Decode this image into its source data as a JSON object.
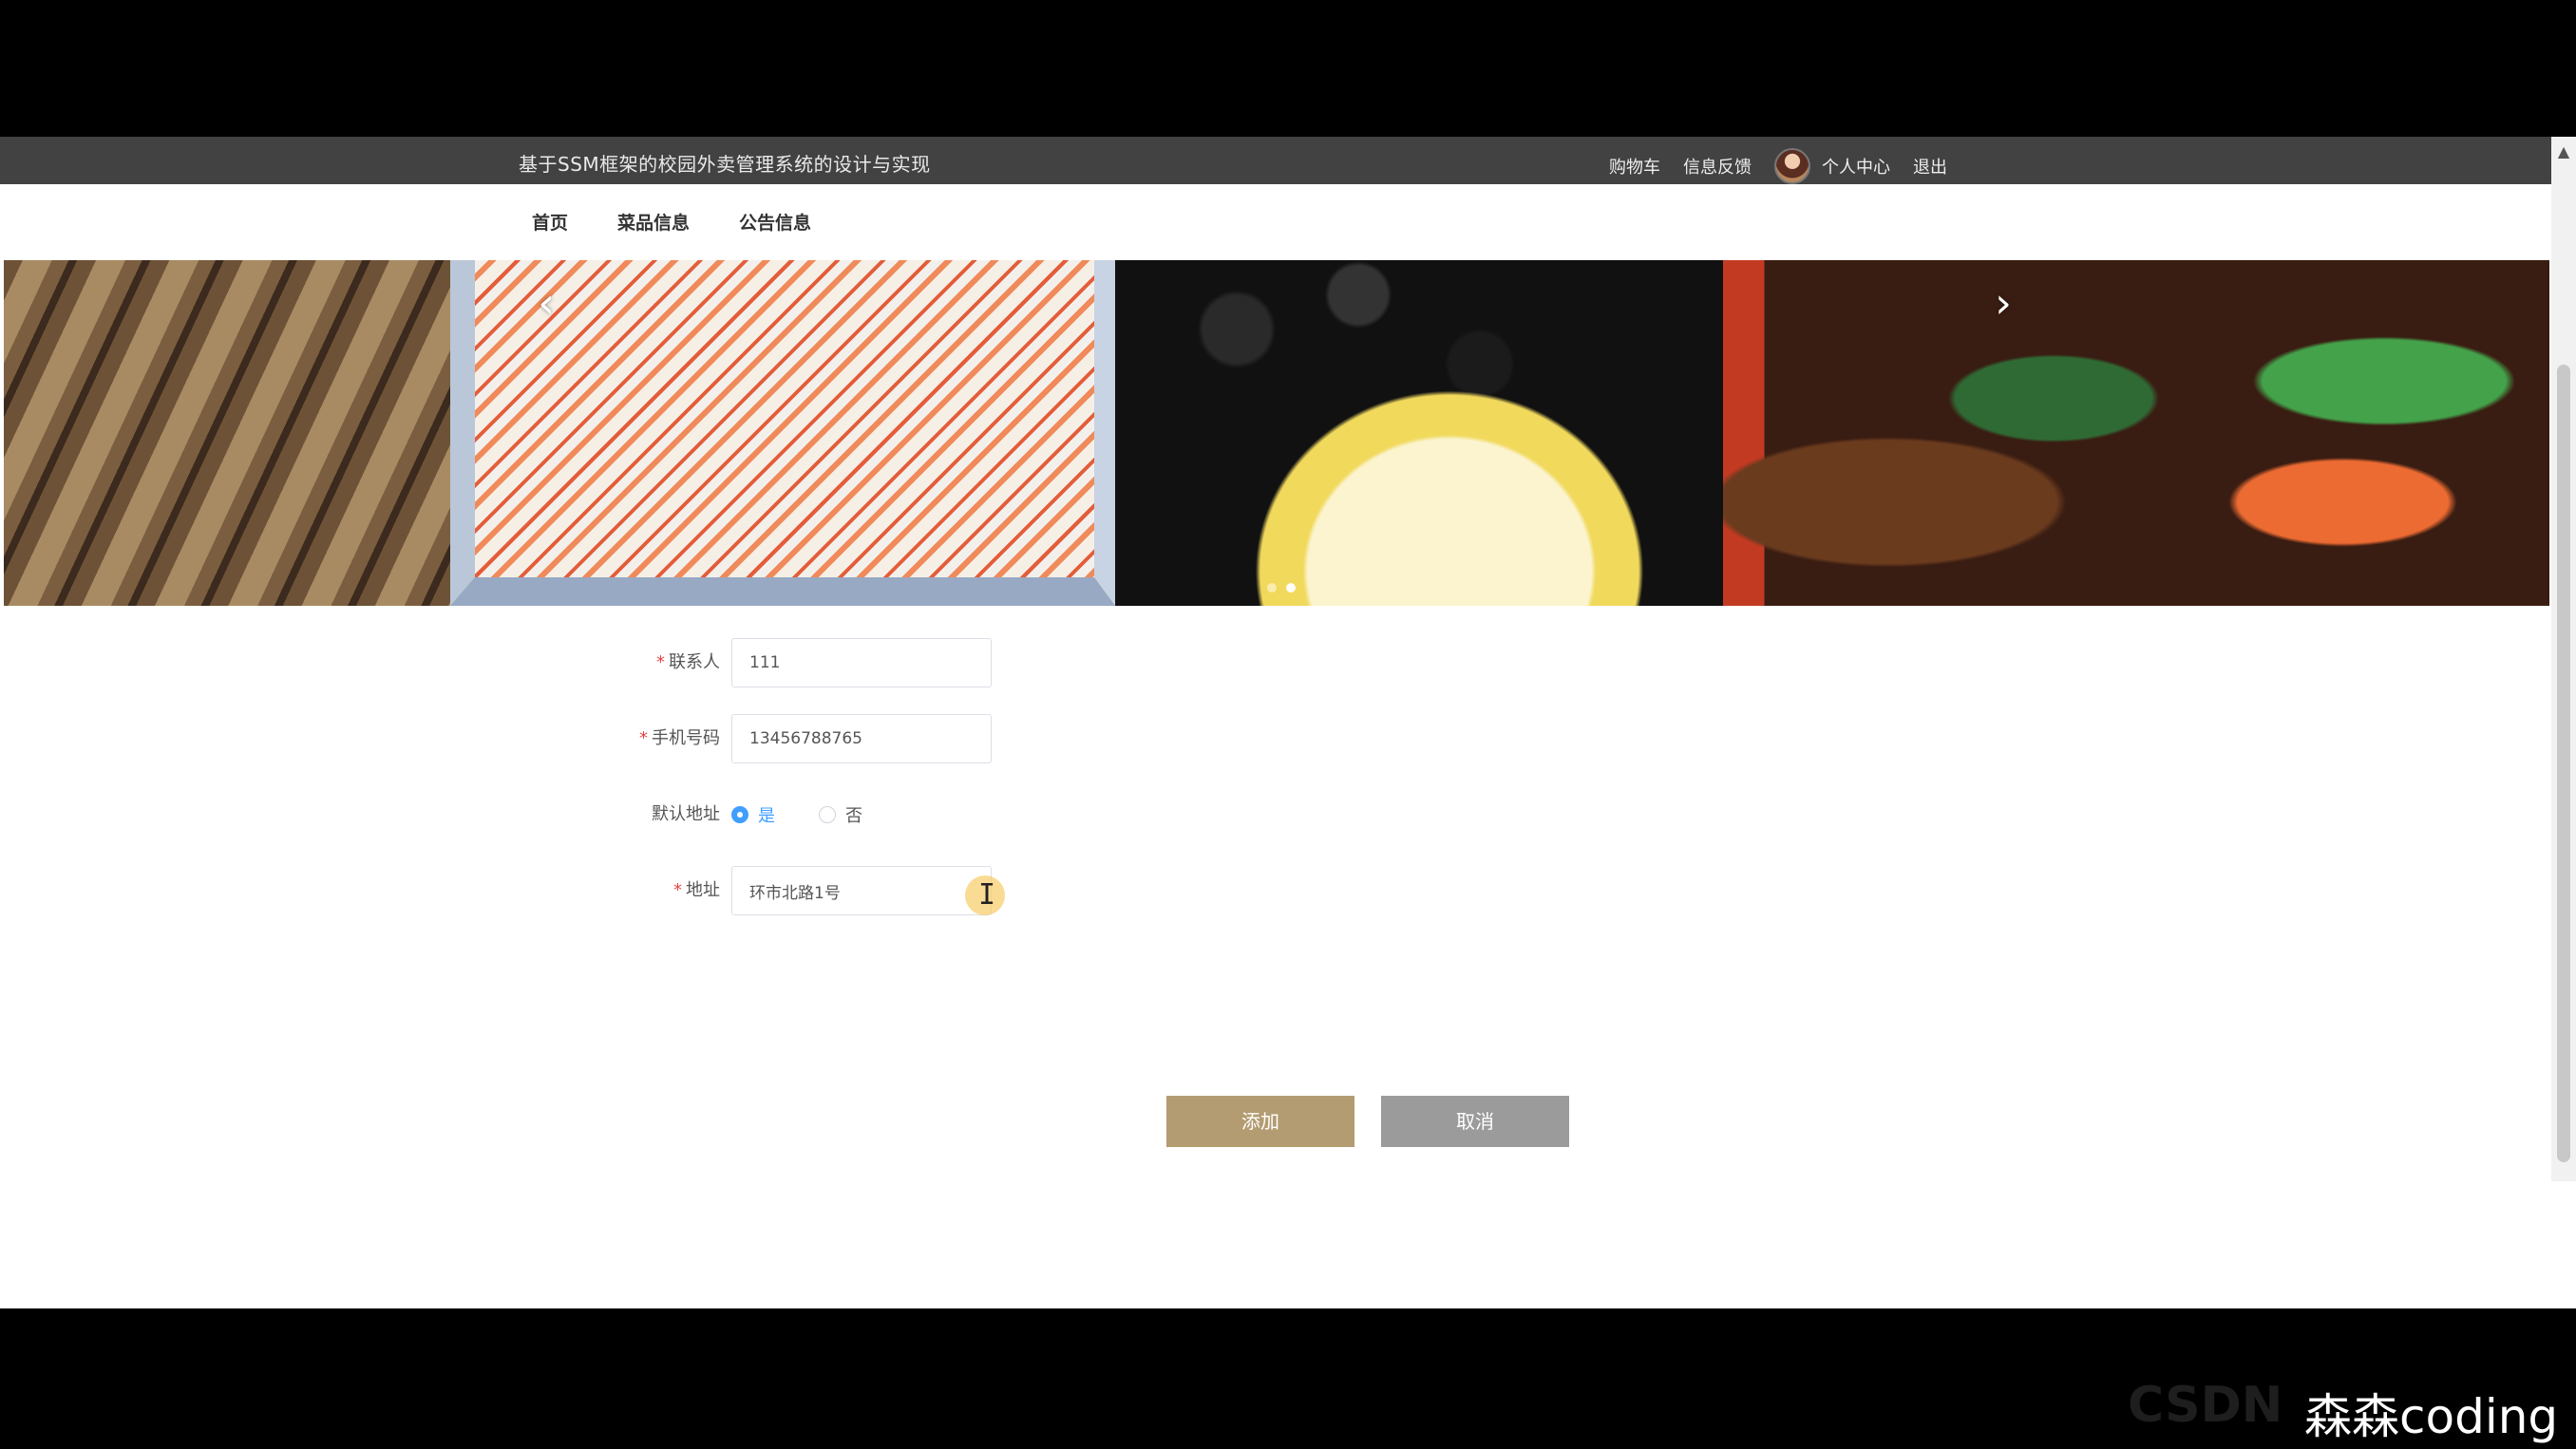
{
  "header": {
    "site_title": "基于SSM框架的校园外卖管理系统的设计与实现",
    "links": {
      "cart": "购物车",
      "feedback": "信息反馈",
      "profile": "个人中心",
      "logout": "退出"
    }
  },
  "nav": {
    "items": [
      "首页",
      "菜品信息",
      "公告信息"
    ]
  },
  "banner": {
    "prev_icon": "‹",
    "next_icon": "›",
    "slide_count": 2,
    "active_index": 1
  },
  "form": {
    "contact": {
      "label": "联系人",
      "required_mark": "*",
      "value": "111"
    },
    "phone": {
      "label": "手机号码",
      "required_mark": "*",
      "value": "13456788765"
    },
    "default_address": {
      "label": "默认地址",
      "options": [
        "是",
        "否"
      ],
      "selected": "是"
    },
    "address": {
      "label": "地址",
      "required_mark": "*",
      "value": "环市北路1号"
    },
    "add_button": "添加",
    "cancel_button": "取消"
  },
  "watermark": {
    "text": "森森coding",
    "faded_text": "CSDN"
  },
  "colors": {
    "topbar": "#424242",
    "add_button": "#b49c72",
    "cancel_button": "#9b9b9b",
    "required": "#e54545",
    "radio_selected": "#409eff"
  }
}
